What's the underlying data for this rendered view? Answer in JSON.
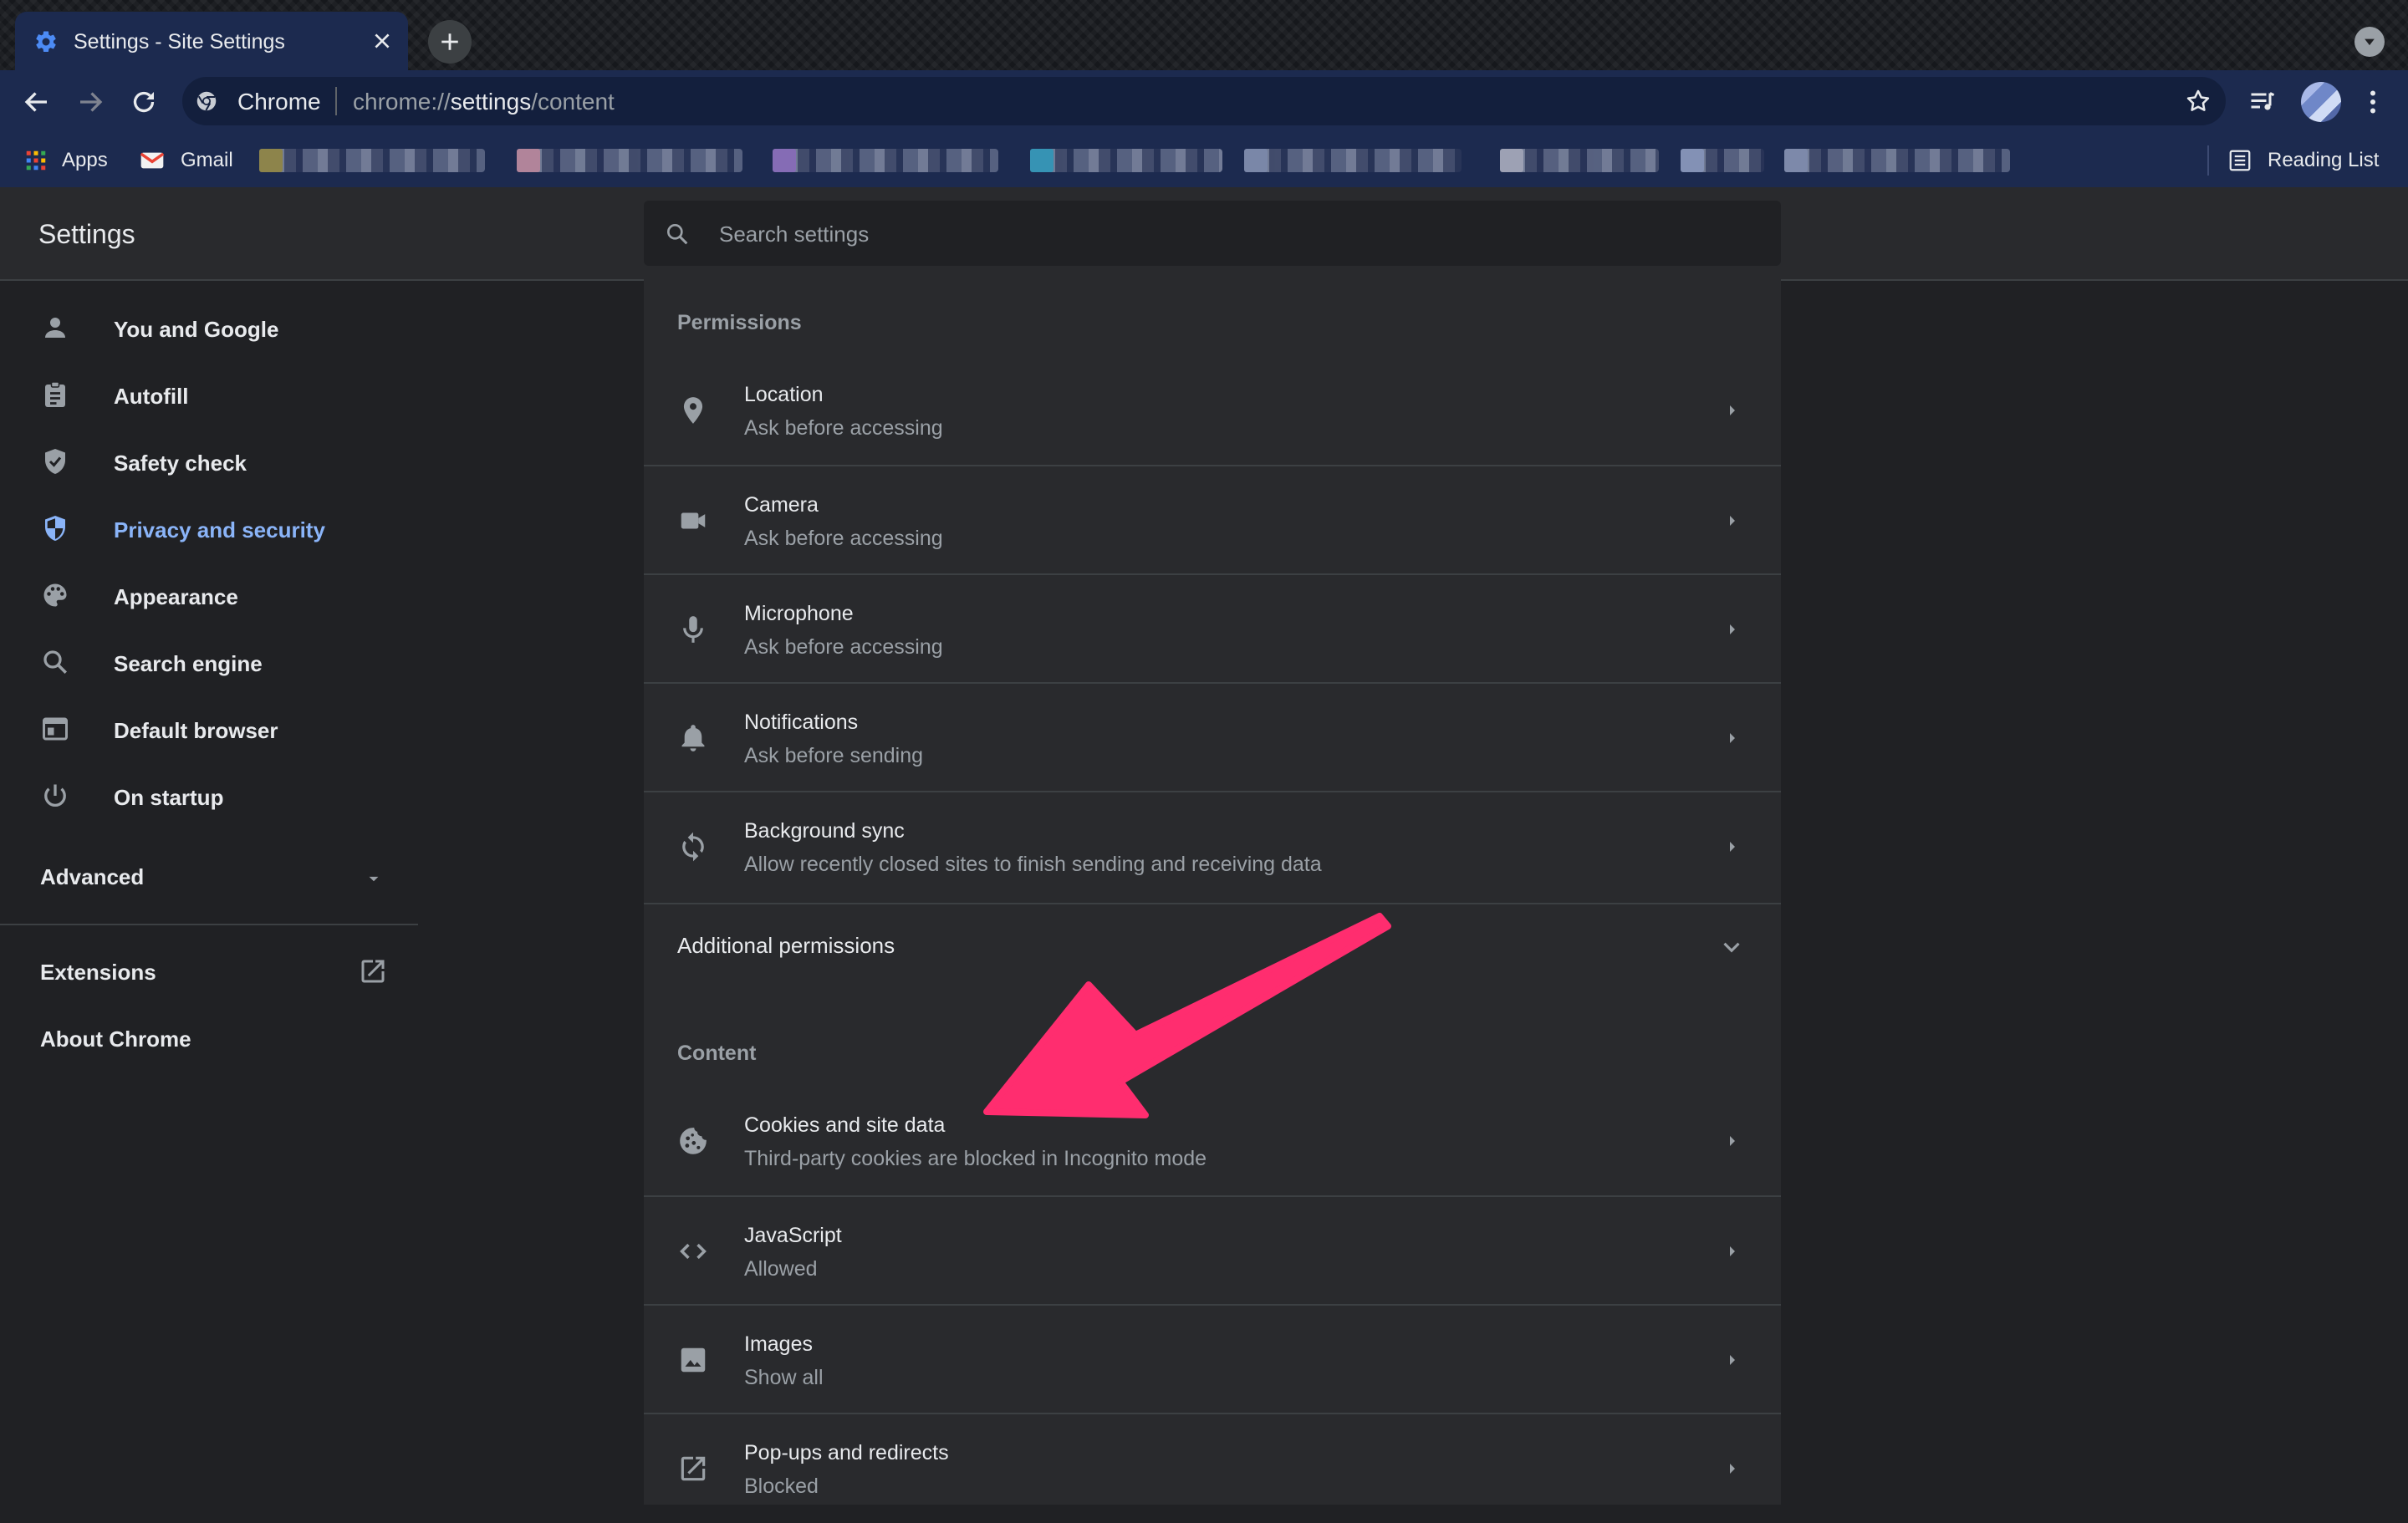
{
  "browser": {
    "tab": {
      "title": "Settings - Site Settings",
      "icon": "gear-icon",
      "close_icon": "close-icon"
    },
    "toolbar": {
      "chip_label": "Chrome",
      "url_scheme": "chrome://",
      "url_host": "settings",
      "url_path": "/content"
    },
    "bookmarks": [
      {
        "label": "Apps",
        "icon": "apps-grid-icon"
      },
      {
        "label": "Gmail",
        "icon": "gmail-icon"
      }
    ],
    "reading_list": "Reading List"
  },
  "settings": {
    "title": "Settings",
    "search": {
      "placeholder": "Search settings"
    },
    "nav": [
      {
        "label": "You and Google",
        "icon": "person-icon"
      },
      {
        "label": "Autofill",
        "icon": "clipboard-icon"
      },
      {
        "label": "Safety check",
        "icon": "shield-check-icon"
      },
      {
        "label": "Privacy and security",
        "icon": "shield-half-icon",
        "active": true
      },
      {
        "label": "Appearance",
        "icon": "palette-icon"
      },
      {
        "label": "Search engine",
        "icon": "search-icon"
      },
      {
        "label": "Default browser",
        "icon": "browser-window-icon"
      },
      {
        "label": "On startup",
        "icon": "power-icon"
      }
    ],
    "advanced": "Advanced",
    "extensions": "Extensions",
    "about": "About Chrome"
  },
  "permissions": {
    "title": "Permissions",
    "items": [
      {
        "title": "Location",
        "subtitle": "Ask before accessing",
        "icon": "location-pin-icon"
      },
      {
        "title": "Camera",
        "subtitle": "Ask before accessing",
        "icon": "videocam-icon"
      },
      {
        "title": "Microphone",
        "subtitle": "Ask before accessing",
        "icon": "microphone-icon"
      },
      {
        "title": "Notifications",
        "subtitle": "Ask before sending",
        "icon": "bell-icon"
      },
      {
        "title": "Background sync",
        "subtitle": "Allow recently closed sites to finish sending and receiving data",
        "icon": "sync-icon"
      }
    ],
    "additional": "Additional permissions"
  },
  "content": {
    "title": "Content",
    "items": [
      {
        "title": "Cookies and site data",
        "subtitle": "Third-party cookies are blocked in Incognito mode",
        "icon": "cookie-icon"
      },
      {
        "title": "JavaScript",
        "subtitle": "Allowed",
        "icon": "code-icon"
      },
      {
        "title": "Images",
        "subtitle": "Show all",
        "icon": "image-icon"
      },
      {
        "title": "Pop-ups and redirects",
        "subtitle": "Blocked",
        "icon": "open-in-new-icon"
      }
    ]
  },
  "colors": {
    "accent": "#8ab4f8",
    "toolbar": "#1c2a4f",
    "page_bg": "#202124",
    "card_bg": "#292a2d",
    "annotation_arrow": "#ff2d6f"
  }
}
